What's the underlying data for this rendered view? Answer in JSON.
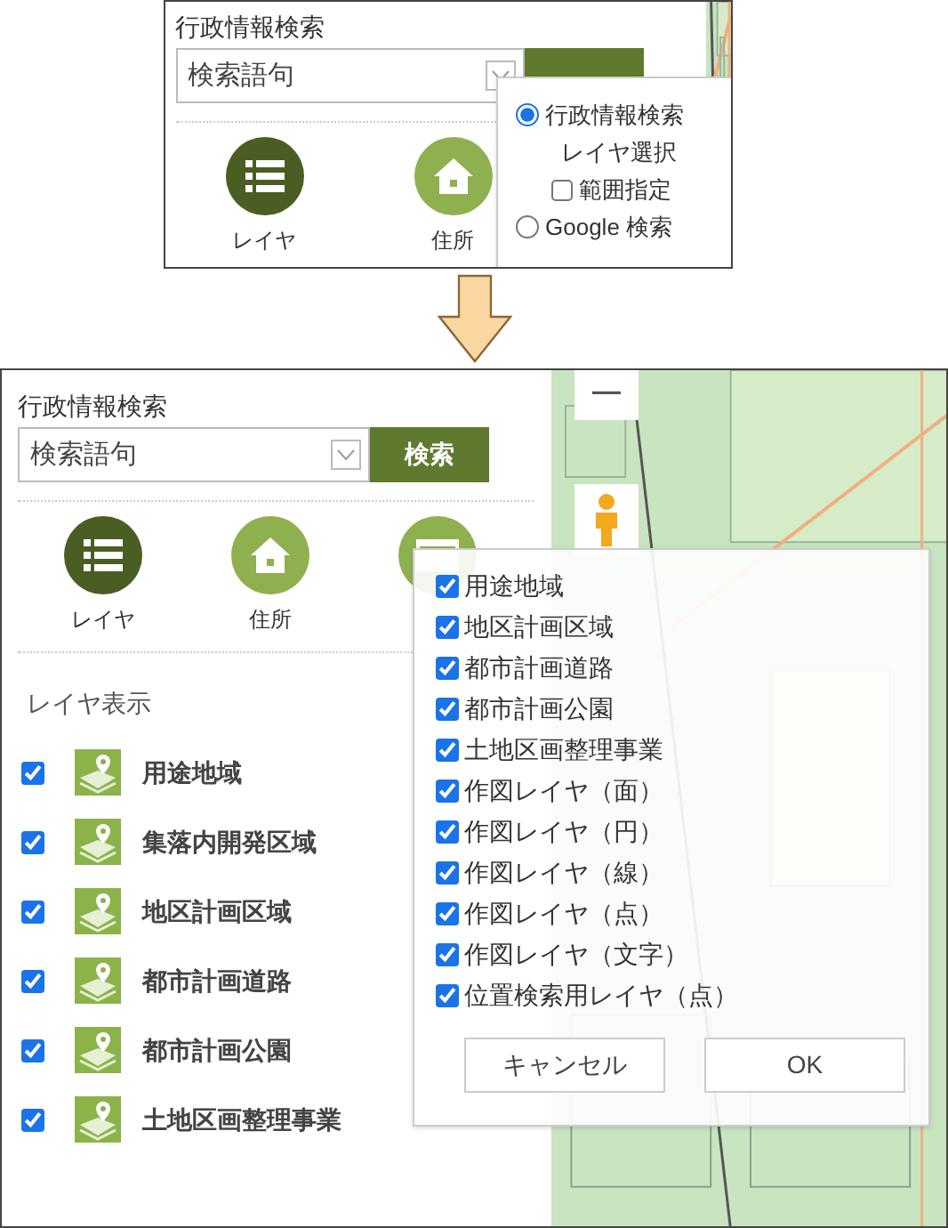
{
  "top_panel": {
    "title": "行政情報検索",
    "search": {
      "value": "検索語句"
    },
    "nav": [
      {
        "label": "レイヤ",
        "selected": true
      },
      {
        "label": "住所",
        "selected": false
      }
    ],
    "search_options": [
      {
        "kind": "radio",
        "label": "行政情報検索",
        "selected": true
      },
      {
        "kind": "text",
        "label": "レイヤ選択"
      },
      {
        "kind": "checkbox",
        "label": "範囲指定",
        "checked": false
      },
      {
        "kind": "radio",
        "label": "Google 検索",
        "selected": false
      }
    ]
  },
  "bottom_panel": {
    "title": "行政情報検索",
    "search": {
      "value": "検索語句"
    },
    "search_button": "検索",
    "nav": [
      {
        "label": "レイヤ",
        "selected": true
      },
      {
        "label": "住所",
        "selected": false
      },
      {
        "selected": false
      }
    ],
    "layer_section": {
      "title": "レイヤ表示",
      "items": [
        {
          "label": "用途地域",
          "checked": true
        },
        {
          "label": "集落内開発区域",
          "checked": true
        },
        {
          "label": "地区計画区域",
          "checked": true
        },
        {
          "label": "都市計画道路",
          "checked": true
        },
        {
          "label": "都市計画公園",
          "checked": true
        },
        {
          "label": "土地区画整理事業",
          "checked": true
        }
      ]
    },
    "map_controls": {
      "zoom_out": "—"
    },
    "layer_dialog": {
      "items": [
        {
          "label": "用途地域",
          "checked": true
        },
        {
          "label": "地区計画区域",
          "checked": true
        },
        {
          "label": "都市計画道路",
          "checked": true
        },
        {
          "label": "都市計画公園",
          "checked": true
        },
        {
          "label": "土地区画整理事業",
          "checked": true
        },
        {
          "label": "作図レイヤ（面）",
          "checked": true
        },
        {
          "label": "作図レイヤ（円）",
          "checked": true
        },
        {
          "label": "作図レイヤ（線）",
          "checked": true
        },
        {
          "label": "作図レイヤ（点）",
          "checked": true
        },
        {
          "label": "作図レイヤ（文字）",
          "checked": true
        },
        {
          "label": "位置検索用レイヤ（点）",
          "checked": true
        }
      ],
      "buttons": [
        "キャンセル",
        "OK"
      ]
    }
  }
}
